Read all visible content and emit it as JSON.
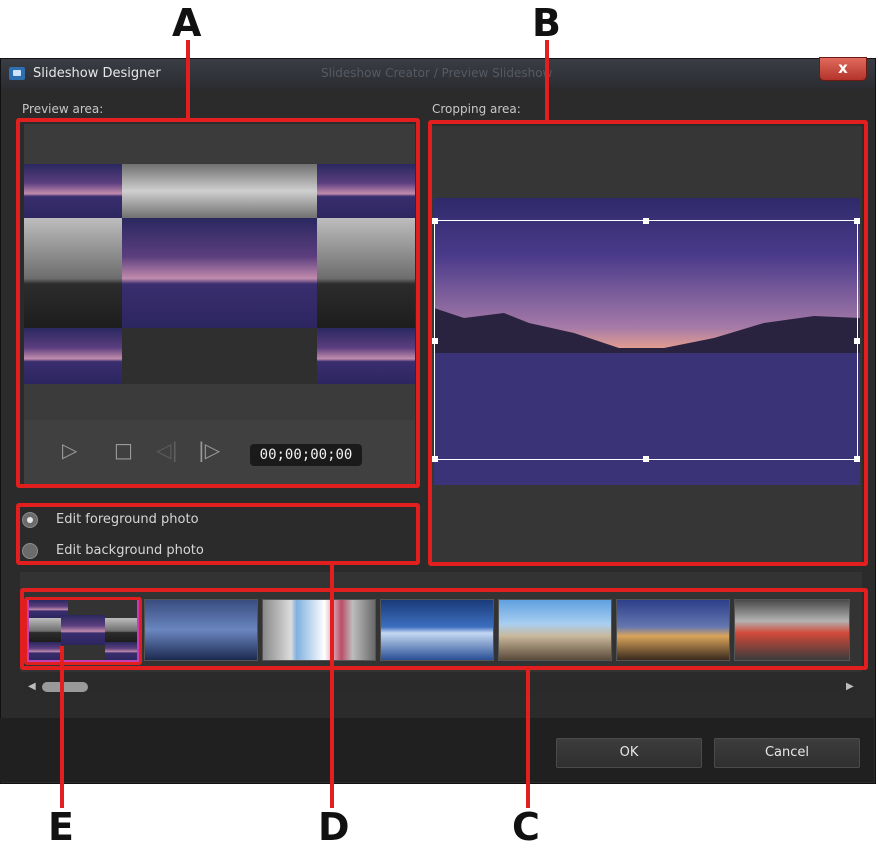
{
  "callouts": {
    "a": "A",
    "b": "B",
    "c": "C",
    "d": "D",
    "e": "E"
  },
  "window": {
    "title": "Slideshow Designer",
    "title_extra": "Slideshow Creator / Preview Slideshow",
    "close_label": "x"
  },
  "preview": {
    "label": "Preview area:",
    "timecode": "00;00;00;00"
  },
  "cropping": {
    "label": "Cropping area:"
  },
  "edit_options": {
    "foreground": "Edit foreground photo",
    "background": "Edit background photo",
    "selected": "foreground"
  },
  "buttons": {
    "ok": "OK",
    "cancel": "Cancel"
  },
  "colors": {
    "highlight": "#e21f1f",
    "selected_thumb": "#c23fb5",
    "window_bg": "#2b2b2b"
  },
  "icons": [
    "play-icon",
    "stop-icon",
    "previous-frame-icon",
    "next-frame-icon",
    "scroll-left-icon",
    "scroll-right-icon"
  ]
}
